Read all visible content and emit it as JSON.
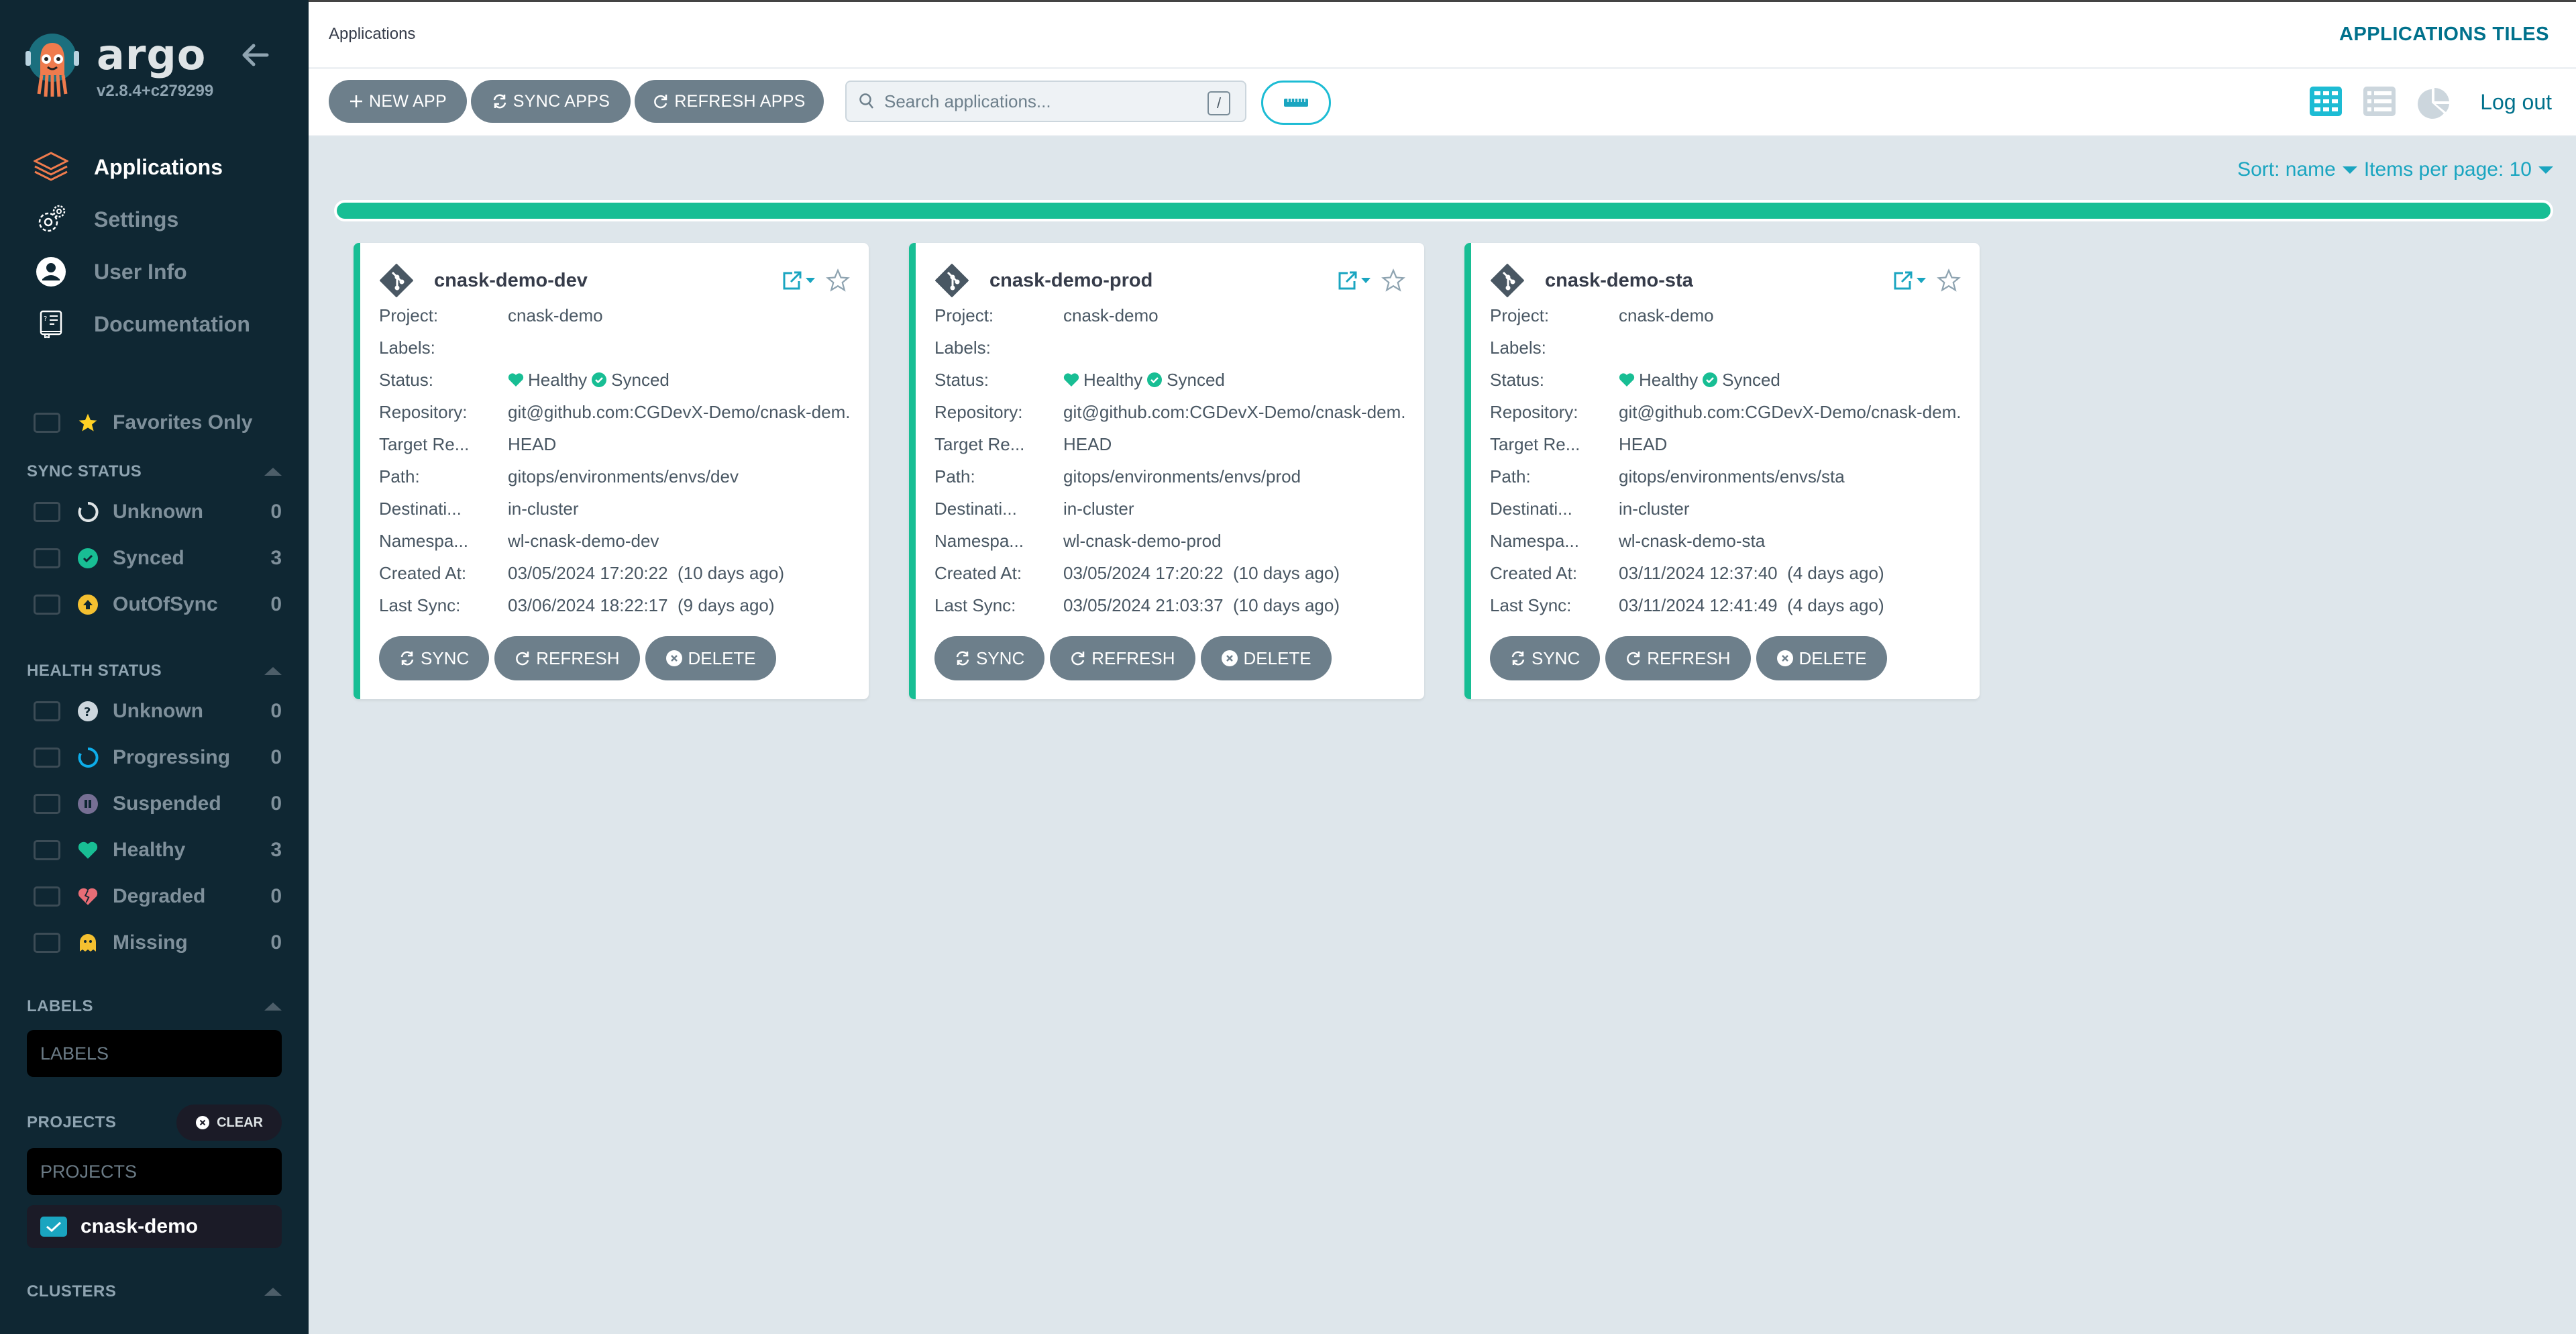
{
  "sidebar": {
    "brand": {
      "name": "argo",
      "version": "v2.8.4+c279299"
    },
    "nav": [
      {
        "label": "Applications",
        "icon": "layers-icon",
        "active": true
      },
      {
        "label": "Settings",
        "icon": "gears-icon",
        "active": false
      },
      {
        "label": "User Info",
        "icon": "user-circle-icon",
        "active": false
      },
      {
        "label": "Documentation",
        "icon": "book-icon",
        "active": false
      }
    ],
    "favorites": {
      "label": "Favorites Only",
      "checked": false
    },
    "sync_status": {
      "title": "SYNC STATUS",
      "items": [
        {
          "label": "Unknown",
          "count": "0",
          "icon": "circle-notch-icon"
        },
        {
          "label": "Synced",
          "count": "3",
          "icon": "check-circle-icon"
        },
        {
          "label": "OutOfSync",
          "count": "0",
          "icon": "arrow-up-circle-icon"
        }
      ]
    },
    "health_status": {
      "title": "HEALTH STATUS",
      "items": [
        {
          "label": "Unknown",
          "count": "0",
          "icon": "question-circle-icon"
        },
        {
          "label": "Progressing",
          "count": "0",
          "icon": "progress-circle-icon"
        },
        {
          "label": "Suspended",
          "count": "0",
          "icon": "pause-circle-icon"
        },
        {
          "label": "Healthy",
          "count": "3",
          "icon": "heart-icon"
        },
        {
          "label": "Degraded",
          "count": "0",
          "icon": "broken-heart-icon"
        },
        {
          "label": "Missing",
          "count": "0",
          "icon": "ghost-icon"
        }
      ]
    },
    "labels": {
      "title": "LABELS",
      "placeholder": "LABELS"
    },
    "projects": {
      "title": "PROJECTS",
      "clear_label": "CLEAR",
      "placeholder": "PROJECTS",
      "selected": [
        {
          "label": "cnask-demo",
          "checked": true
        }
      ]
    },
    "clusters": {
      "title": "CLUSTERS"
    }
  },
  "header": {
    "breadcrumb": "Applications",
    "title": "APPLICATIONS TILES"
  },
  "toolbar": {
    "new_app": "NEW APP",
    "sync_apps": "SYNC APPS",
    "refresh_apps": "REFRESH APPS",
    "search_placeholder": "Search applications...",
    "search_value": "",
    "search_shortcut": "/",
    "logout": "Log out"
  },
  "sort": {
    "sort_label": "Sort: name",
    "per_page_label": "Items per page: 10"
  },
  "progress": {
    "percent": 100
  },
  "colors": {
    "healthy": "#18be94",
    "accent": "#1aa5c0",
    "brand_text": "#00718c"
  },
  "card_labels": {
    "project": "Project:",
    "labels": "Labels:",
    "status": "Status:",
    "repository": "Repository:",
    "target": "Target Re...",
    "path": "Path:",
    "destination": "Destinati...",
    "namespace": "Namespa...",
    "created": "Created At:",
    "last_sync": "Last Sync:",
    "sync_btn": "SYNC",
    "refresh_btn": "REFRESH",
    "delete_btn": "DELETE"
  },
  "apps": [
    {
      "name": "cnask-demo-dev",
      "project": "cnask-demo",
      "labels": "",
      "health": "Healthy",
      "sync": "Synced",
      "repository": "git@github.com:CGDevX-Demo/cnask-dem...",
      "target": "HEAD",
      "path": "gitops/environments/envs/dev",
      "destination": "in-cluster",
      "namespace": "wl-cnask-demo-dev",
      "created": "03/05/2024 17:20:22  (10 days ago)",
      "last_sync": "03/06/2024 18:22:17  (9 days ago)"
    },
    {
      "name": "cnask-demo-prod",
      "project": "cnask-demo",
      "labels": "",
      "health": "Healthy",
      "sync": "Synced",
      "repository": "git@github.com:CGDevX-Demo/cnask-dem...",
      "target": "HEAD",
      "path": "gitops/environments/envs/prod",
      "destination": "in-cluster",
      "namespace": "wl-cnask-demo-prod",
      "created": "03/05/2024 17:20:22  (10 days ago)",
      "last_sync": "03/05/2024 21:03:37  (10 days ago)"
    },
    {
      "name": "cnask-demo-sta",
      "project": "cnask-demo",
      "labels": "",
      "health": "Healthy",
      "sync": "Synced",
      "repository": "git@github.com:CGDevX-Demo/cnask-dem...",
      "target": "HEAD",
      "path": "gitops/environments/envs/sta",
      "destination": "in-cluster",
      "namespace": "wl-cnask-demo-sta",
      "created": "03/11/2024 12:37:40  (4 days ago)",
      "last_sync": "03/11/2024 12:41:49  (4 days ago)"
    }
  ]
}
